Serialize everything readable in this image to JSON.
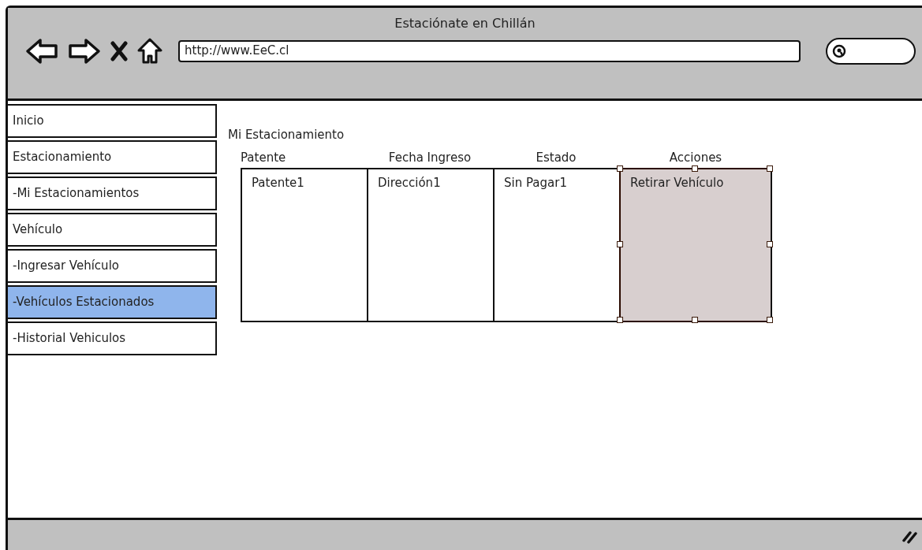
{
  "window": {
    "title": "Estaciónate en Chillán"
  },
  "address_bar": {
    "value": "http://www.EeC.cl"
  },
  "sidebar": {
    "items": [
      {
        "label": "Inicio",
        "selected": false
      },
      {
        "label": "Estacionamiento",
        "selected": false
      },
      {
        "label": "-Mi Estacionamientos",
        "selected": false
      },
      {
        "label": "Vehículo",
        "selected": false
      },
      {
        "label": "-Ingresar Vehículo",
        "selected": false
      },
      {
        "label": "-Vehículos Estacionados",
        "selected": true
      },
      {
        "label": "-Historial Vehiculos",
        "selected": false
      }
    ]
  },
  "content": {
    "heading": "Mi Estacionamiento",
    "table": {
      "columns": [
        {
          "header": "Patente",
          "cell": "Patente1",
          "selected": false
        },
        {
          "header": "Fecha Ingreso",
          "cell": "Dirección1",
          "selected": false
        },
        {
          "header": "Estado",
          "cell": "Sin Pagar1",
          "selected": false
        },
        {
          "header": "Acciones",
          "cell": "Retirar Vehículo",
          "selected": true
        }
      ]
    }
  }
}
